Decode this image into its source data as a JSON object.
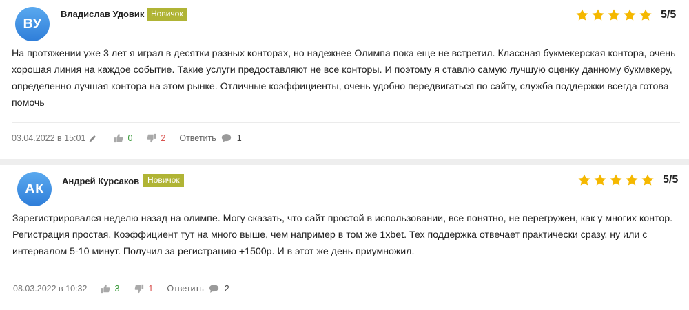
{
  "reviews": [
    {
      "initials": "ВУ",
      "author": "Владислав Удовик",
      "badge": "Новичок",
      "rating": "5/5",
      "stars": 5,
      "text": "На протяжении уже 3 лет я играл в десятки разных конторах, но надежнее Олимпа пока еще не встретил. Классная букмекерская контора, очень хорошая линия на каждое событие. Такие услуги предоставляют не все конторы. И поэтому я ставлю самую лучшую оценку данному букмекеру, определенно лучшая контора на этом рынке. Отличные коэффициенты, очень удобно передвигаться по сайту, служба поддержки всегда готова помочь",
      "date": "03.04.2022 в 15:01",
      "likes": "0",
      "dislikes": "2",
      "reply_label": "Ответить",
      "comments": "1"
    },
    {
      "initials": "АК",
      "author": "Андрей Курсаков",
      "badge": "Новичок",
      "rating": "5/5",
      "stars": 5,
      "text": "Зарегистрировался неделю назад на олимпе. Могу сказать, что сайт простой в использовании, все понятно, не перегружен, как у многих контор. Регистрация простая. Коэффициент тут на много выше, чем например в том же 1xbet. Тех поддержка отвечает практически сразу, ну или с интервалом 5-10 минут. Получил за регистрацию +1500р. И в этот же день приумножил.",
      "date": "08.03.2022 в 10:32",
      "likes": "3",
      "dislikes": "1",
      "reply_label": "Ответить",
      "comments": "2"
    }
  ],
  "colors": {
    "avatar": "#3f8fe3",
    "badge": "#b0b435",
    "star": "#f5b800",
    "likes": "#3a9a3a",
    "dislikes": "#d9534f"
  },
  "icons": [
    "pencil-icon",
    "thumbs-up-icon",
    "thumbs-down-icon",
    "comment-icon",
    "star-icon"
  ]
}
